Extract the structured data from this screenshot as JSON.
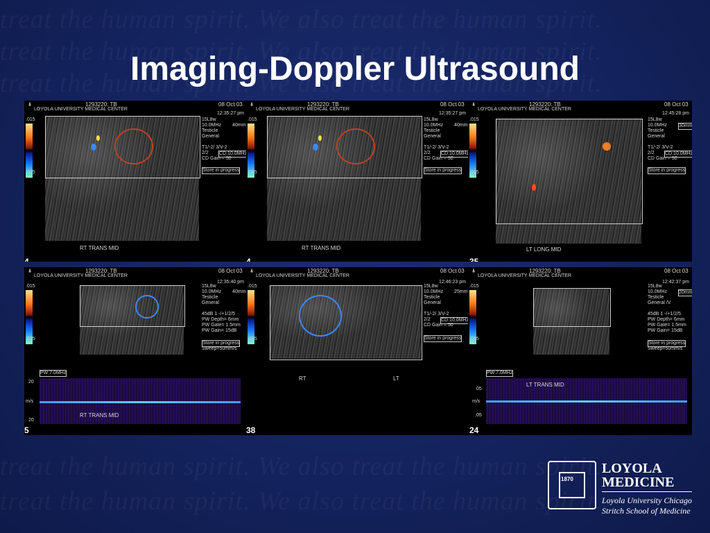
{
  "slide": {
    "title": "Imaging-Doppler Ultrasound"
  },
  "panels": [
    {
      "header_id": "1293220: TB",
      "date": "08 Oct 03",
      "institution": "LOYOLA UNIVERSITY MEDICAL CENTER",
      "time": "12:35:27 pm",
      "scale_top": ".015",
      "scale_bottom": ".015",
      "params": [
        "15L8w",
        "10.0MHz",
        "Testicle",
        "General"
      ],
      "depth": "40mm",
      "settings": [
        "T1/-2/ 3/V-2",
        "2/2",
        "CD Gain = 50"
      ],
      "cd_freq": "CD:10.0MHz",
      "status": "Store in progress",
      "label": "RT TRANS     MID",
      "index": "4"
    },
    {
      "header_id": "1293220: TB",
      "date": "08 Oct 03",
      "institution": "LOYOLA UNIVERSITY MEDICAL CENTER",
      "time": "12:35:27 pm",
      "scale_top": ".015",
      "scale_bottom": ".015",
      "params": [
        "15L8w",
        "10.0MHz",
        "Testicle",
        "General"
      ],
      "depth": "40mm",
      "settings": [
        "T1/-2/ 3/V-2",
        "2/2",
        "CD Gain = 50"
      ],
      "cd_freq": "CD:10.0MHz",
      "status": "Store in progress",
      "label": "RT TRANS     MID",
      "index": "4"
    },
    {
      "header_id": "1293220: TB",
      "date": "08 Oct 03",
      "institution": "LOYOLA UNIVERSITY MEDICAL CENTER",
      "time": "12:45:28 pm",
      "scale_top": ".015",
      "scale_bottom": ".015",
      "params": [
        "15L8w",
        "10.0MHz",
        "Testicle",
        "General"
      ],
      "depth": "30mm",
      "settings": [
        "T1/-2/ 3/V-2",
        "2/2",
        "CD Gain = 50"
      ],
      "cd_freq": "CD:10.0MHz",
      "status": "Store in progress",
      "label": "LT LONG    MID",
      "index": "35"
    },
    {
      "header_id": "1293220: TB",
      "date": "08 Oct 03",
      "institution": "LOYOLA UNIVERSITY MEDICAL CENTER",
      "time": "12:35:40 pm",
      "scale_top": ".015",
      "scale_bottom": ".015",
      "params": [
        "15L8w",
        "10.0MHz",
        "Testicle",
        "General"
      ],
      "depth": "40mm",
      "settings": [
        "45dB  1 -/+1/2/5",
        "PW Depth=   6mm",
        "PW Gate=  1.5mm",
        "PW Gain= 15dB"
      ],
      "status": "Store in progress",
      "sweep": "Sweep=50mm/s",
      "pw": "PW:7.0MHz",
      "spectral_top": "20",
      "spectral_mid": "m/s",
      "spectral_bottom": "20",
      "label": "RT TRANS     MID",
      "index": "5"
    },
    {
      "header_id": "1293220: TB",
      "date": "08 Oct 03",
      "institution": "LOYOLA UNIVERSITY MEDICAL CENTER",
      "time": "12:46:23 pm",
      "scale_top": ".015",
      "scale_bottom": ".015",
      "params": [
        "15L8w",
        "10.0MHz",
        "Testicle",
        "General"
      ],
      "depth": "25mm",
      "settings": [
        "T1/-2/ 3/V-2",
        "2/2",
        "CD Gain = 50"
      ],
      "cd_freq": "CD:10.0MHz",
      "status": "Store in progress",
      "label_left": "RT",
      "label_right": "LT",
      "index": "38"
    },
    {
      "header_id": "1293220: TB",
      "date": "08 Oct 03",
      "institution": "LOYOLA UNIVERSITY MEDICAL CENTER",
      "time": "12:42:37 pm",
      "scale_top": ".015",
      "scale_bottom": ".015",
      "params": [
        "15L8w",
        "10.0MHz",
        "Testicle",
        "General /V"
      ],
      "depth": "20mm",
      "settings": [
        "45dB  1 -/+1/2/5",
        "PW Depth=   6mm",
        "PW Gate=  1.5mm",
        "PW Gain= 15dB"
      ],
      "status": "Store in progress",
      "sweep": "Sweep=50mm/s",
      "pw": "PW:7.0MHz",
      "spectral_top": ".05",
      "spectral_mid": "m/s",
      "spectral_bottom": ".05",
      "label": "LT TRANS     MID",
      "index": "24"
    }
  ],
  "logo": {
    "seal_year": "1870",
    "name_line1": "LOYOLA",
    "name_line2": "MEDICINE",
    "sub_line1": "Loyola University Chicago",
    "sub_line2": "Stritch School of Medicine",
    "motto": "AD·MAJOREM·DEI·GLORIAM"
  },
  "watermark_text": "treat the human spirit. We also treat the human spirit."
}
